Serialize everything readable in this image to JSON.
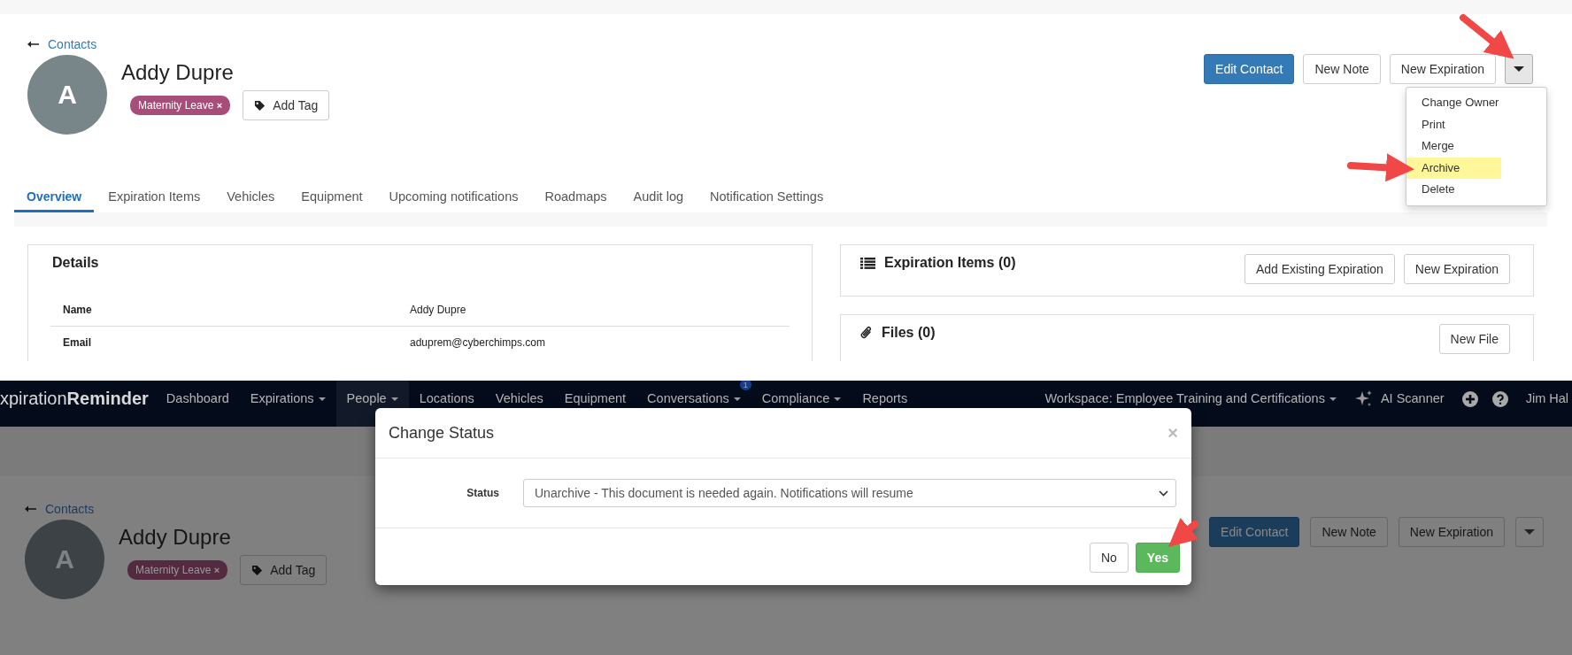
{
  "top_screen": {
    "back_link": "Contacts",
    "contact": {
      "avatar_initial": "A",
      "name": "Addy Dupre",
      "tags": [
        {
          "label": "Maternity Leave",
          "remove": "×"
        }
      ],
      "add_tag": "Add Tag"
    },
    "actions": [
      {
        "label": "Edit Contact",
        "kind": "primary"
      },
      {
        "label": "New Note",
        "kind": "default"
      },
      {
        "label": "New Expiration",
        "kind": "default"
      }
    ],
    "more_menu": {
      "expanded": true,
      "items": [
        {
          "label": "Change Owner",
          "selected": false
        },
        {
          "label": "Print",
          "selected": false
        },
        {
          "label": "Merge",
          "selected": false
        },
        {
          "label": "Archive",
          "selected": true
        },
        {
          "label": "Delete",
          "selected": false
        }
      ]
    },
    "tabs": [
      {
        "label": "Overview",
        "selected": true
      },
      {
        "label": "Expiration Items",
        "selected": false
      },
      {
        "label": "Vehicles",
        "selected": false
      },
      {
        "label": "Equipment",
        "selected": false
      },
      {
        "label": "Upcoming notifications",
        "selected": false
      },
      {
        "label": "Roadmaps",
        "selected": false
      },
      {
        "label": "Audit log",
        "selected": false
      },
      {
        "label": "Notification Settings",
        "selected": false
      }
    ],
    "details": {
      "title": "Details",
      "rows": [
        {
          "label": "Name",
          "value": "Addy Dupre"
        },
        {
          "label": "Email",
          "value": "aduprem@cyberchimps.com"
        }
      ]
    },
    "expiration_items": {
      "title": "Expiration Items (0)",
      "buttons": [
        "Add Existing Expiration",
        "New Expiration"
      ]
    },
    "files": {
      "title": "Files (0)",
      "buttons": [
        "New File"
      ]
    }
  },
  "bottom_screen": {
    "navbar": {
      "logo": "xpiration**Reminder**",
      "items": [
        {
          "label": "Dashboard",
          "dropdown": false,
          "selected": false
        },
        {
          "label": "Expirations",
          "dropdown": true,
          "selected": false
        },
        {
          "label": "People",
          "dropdown": true,
          "selected": true
        },
        {
          "label": "Locations",
          "dropdown": false,
          "selected": false
        },
        {
          "label": "Vehicles",
          "dropdown": false,
          "selected": false
        },
        {
          "label": "Equipment",
          "dropdown": false,
          "selected": false
        },
        {
          "label": "Conversations",
          "dropdown": true,
          "selected": false,
          "badge": "1"
        },
        {
          "label": "Compliance",
          "dropdown": true,
          "selected": false
        },
        {
          "label": "Reports",
          "dropdown": false,
          "selected": false
        }
      ],
      "workspace": "Workspace: Employee Training and Certifications",
      "ai_scanner": "AI Scanner",
      "user": "Jim Hal"
    },
    "back_link": "Contacts",
    "contact": {
      "avatar_initial": "A",
      "name": "Addy Dupre",
      "tags": [
        {
          "label": "Maternity Leave",
          "remove": "×"
        }
      ],
      "add_tag": "Add Tag"
    },
    "actions": [
      {
        "label": "Edit Contact",
        "kind": "primary"
      },
      {
        "label": "New Note",
        "kind": "default"
      },
      {
        "label": "New Expiration",
        "kind": "default"
      }
    ],
    "modal": {
      "title": "Change Status",
      "close": "×",
      "status_label": "Status",
      "status_value": "Unarchive - This document is needed again. Notifications will resume",
      "buttons": [
        {
          "label": "No",
          "kind": "default"
        },
        {
          "label": "Yes",
          "kind": "success"
        }
      ]
    }
  }
}
